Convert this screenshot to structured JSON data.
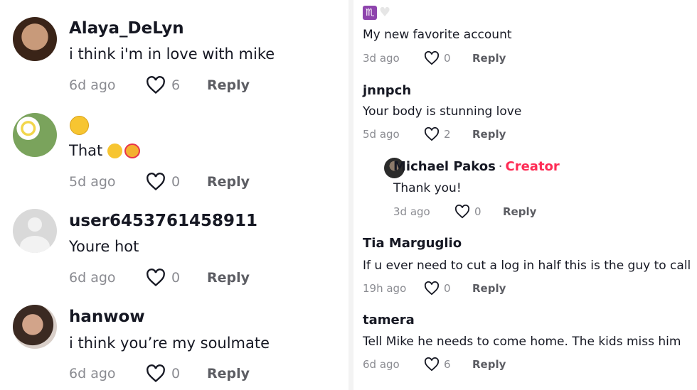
{
  "left": {
    "comments": [
      {
        "username": "Alaya_DeLyn",
        "text": "i think i'm in love with mike",
        "time": "6d ago",
        "likes": "6",
        "reply": "Reply"
      },
      {
        "username": "",
        "text": "That",
        "time": "5d ago",
        "likes": "0",
        "reply": "Reply"
      },
      {
        "username": "user6453761458911",
        "text": "Youre hot",
        "time": "6d ago",
        "likes": "0",
        "reply": "Reply"
      },
      {
        "username": "hanwow",
        "text": "i think you’re my soulmate",
        "time": "6d ago",
        "likes": "0",
        "reply": "Reply"
      }
    ]
  },
  "right": {
    "comments": [
      {
        "username": "",
        "text": "My new favorite account",
        "time": "3d ago",
        "likes": "0",
        "reply": "Reply"
      },
      {
        "username": "jnnpch",
        "text": "Your body is stunning love",
        "time": "5d ago",
        "likes": "2",
        "reply": "Reply"
      },
      {
        "username": "Michael Pakos",
        "creator_sep": "·",
        "creator_label": "Creator",
        "text": "Thank you!",
        "time": "3d ago",
        "likes": "0",
        "reply": "Reply"
      },
      {
        "username": "Tia Marguglio",
        "text": "If u ever need to cut a log in half this is the guy to call",
        "time": "19h ago",
        "likes": "0",
        "reply": "Reply"
      },
      {
        "username": "tamera",
        "text": "Tell Mike he needs to come home. The kids miss him",
        "time": "6d ago",
        "likes": "6",
        "reply": "Reply"
      }
    ]
  },
  "colors": {
    "creator": "#fe2c55",
    "meta": "#8a8b91",
    "text": "#161823"
  },
  "icons": {
    "like": "heart-outline-icon",
    "zodiac": "scorpio-icon"
  }
}
